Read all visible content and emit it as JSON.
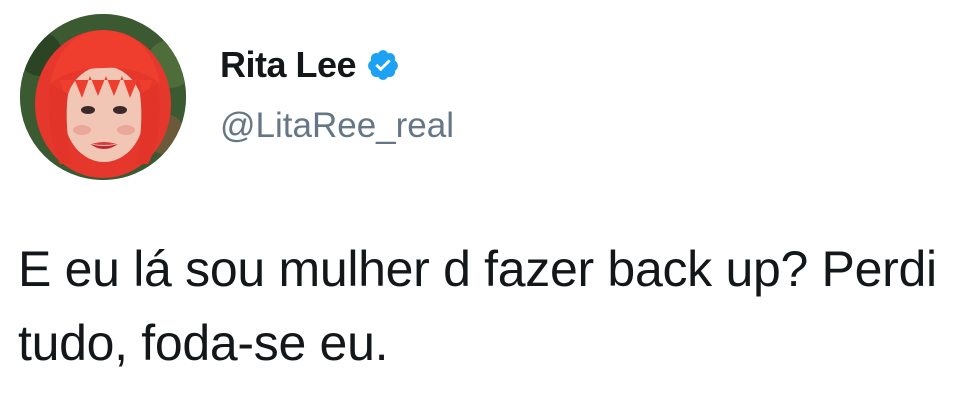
{
  "tweet": {
    "author": {
      "name": "Rita Lee",
      "handle": "@LitaRee_real",
      "verified": true,
      "verified_icon": "verified-badge-icon",
      "avatar_icon": "avatar-photo"
    },
    "text": "E eu lá sou mulher d fazer back up? Perdi tudo, foda-se eu."
  },
  "colors": {
    "name": "#14171a",
    "handle": "#657786",
    "text": "#14171a",
    "verified_badge": "#1da1f2",
    "background": "#ffffff"
  }
}
